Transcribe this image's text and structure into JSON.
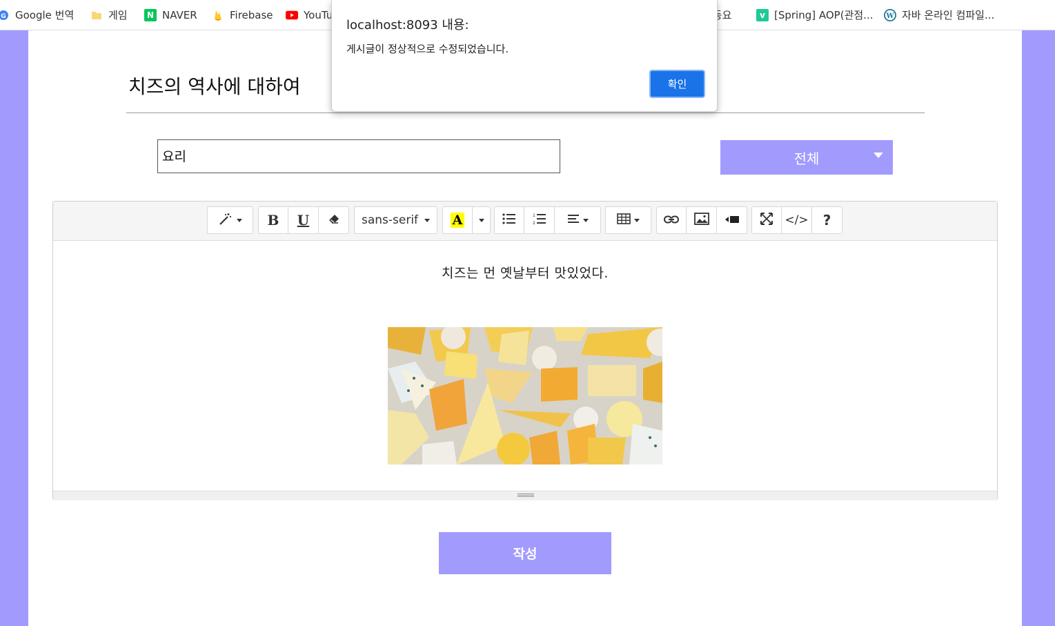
{
  "bookmarks": [
    {
      "label": "Google 번역",
      "icon": "google-translate-icon"
    },
    {
      "label": "게임",
      "icon": "folder-icon"
    },
    {
      "label": "NAVER",
      "icon": "naver-icon",
      "badge": "N"
    },
    {
      "label": "Firebase",
      "icon": "firebase-icon"
    },
    {
      "label": "YouTu",
      "icon": "youtube-icon"
    },
    {
      "label": "노동요",
      "icon": "bookmark-icon"
    },
    {
      "label": "[Spring] AOP(관점...",
      "icon": "velog-icon",
      "badge": "v"
    },
    {
      "label": "자바 온라인 컴파일...",
      "icon": "wordpress-icon"
    }
  ],
  "page": {
    "title": "치즈의 역사에 대하여",
    "category_value": "요리",
    "select_value": "전체",
    "submit_label": "작성"
  },
  "editor": {
    "toolbar": {
      "style_icon": "magic-wand-icon",
      "bold": "B",
      "underline": "U",
      "clear_icon": "eraser-icon",
      "font_name": "sans-serif",
      "color_letter": "A",
      "unordered_list_icon": "unordered-list-icon",
      "ordered_list_icon": "ordered-list-icon",
      "paragraph_icon": "align-left-icon",
      "table_icon": "table-icon",
      "link_icon": "link-icon",
      "picture_icon": "picture-icon",
      "video_icon": "video-icon",
      "fullscreen_icon": "fullscreen-icon",
      "codeview_label": "</>",
      "help_label": "?"
    },
    "content_text": "치즈는 먼 옛날부터 맛있었다.",
    "image_icon": "cheese-photo"
  },
  "dialog": {
    "title": "localhost:8093 내용:",
    "message": "게시글이 정상적으로 수정되었습니다.",
    "ok_label": "확인"
  },
  "colors": {
    "accent": "#a29bfe",
    "dialog_button": "#1a73e8",
    "highlight_yellow": "#ffff00"
  }
}
